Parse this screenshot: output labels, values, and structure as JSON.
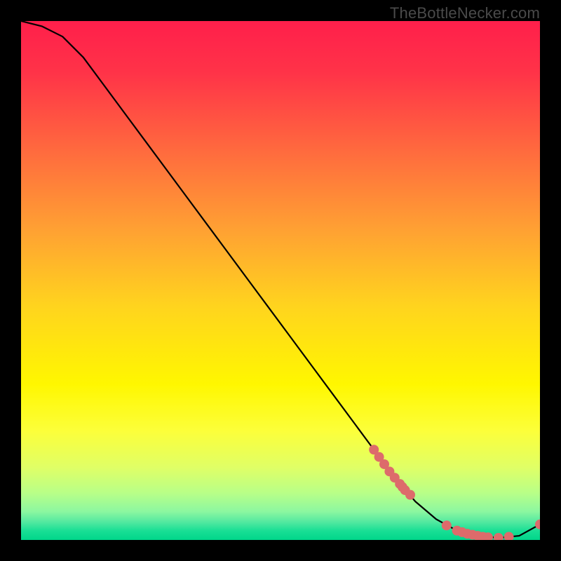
{
  "attribution": "TheBottleNecker.com",
  "chart_data": {
    "type": "line",
    "title": "",
    "xlabel": "",
    "ylabel": "",
    "xlim": [
      0,
      100
    ],
    "ylim": [
      0,
      100
    ],
    "grid": false,
    "legend": false,
    "series": [
      {
        "name": "bottleneck-curve",
        "x": [
          0,
          4,
          8,
          12,
          16,
          20,
          24,
          28,
          32,
          36,
          40,
          44,
          48,
          52,
          56,
          60,
          64,
          68,
          72,
          76,
          80,
          84,
          88,
          92,
          96,
          100
        ],
        "values": [
          100,
          99,
          97,
          93.0,
          87.6,
          82.2,
          76.8,
          71.4,
          66.0,
          60.6,
          55.2,
          49.8,
          44.4,
          39.0,
          33.6,
          28.2,
          22.8,
          17.4,
          12.0,
          7.4,
          4.0,
          1.8,
          0.8,
          0.4,
          0.8,
          3.0
        ]
      }
    ],
    "markers": {
      "name": "highlight-dots",
      "color": "#dd6b6b",
      "x": [
        68,
        69,
        70,
        71,
        72,
        73,
        73.5,
        74,
        75,
        82,
        84,
        85,
        86,
        87,
        88,
        89,
        90,
        92,
        94,
        100
      ],
      "values": [
        17.4,
        16.0,
        14.6,
        13.2,
        12.0,
        10.8,
        10.2,
        9.6,
        8.7,
        2.8,
        1.8,
        1.5,
        1.2,
        1.0,
        0.8,
        0.6,
        0.5,
        0.4,
        0.6,
        3.0
      ]
    },
    "background_gradient_stops": [
      {
        "offset": 0.0,
        "color": "#ff1f4b"
      },
      {
        "offset": 0.1,
        "color": "#ff3348"
      },
      {
        "offset": 0.25,
        "color": "#ff6a3e"
      },
      {
        "offset": 0.4,
        "color": "#ffa033"
      },
      {
        "offset": 0.55,
        "color": "#ffd41e"
      },
      {
        "offset": 0.7,
        "color": "#fff700"
      },
      {
        "offset": 0.79,
        "color": "#fcff3a"
      },
      {
        "offset": 0.86,
        "color": "#e0ff66"
      },
      {
        "offset": 0.91,
        "color": "#b8ff88"
      },
      {
        "offset": 0.945,
        "color": "#8cf7a0"
      },
      {
        "offset": 0.965,
        "color": "#54e9a0"
      },
      {
        "offset": 0.982,
        "color": "#1adf95"
      },
      {
        "offset": 1.0,
        "color": "#00d68a"
      }
    ]
  }
}
